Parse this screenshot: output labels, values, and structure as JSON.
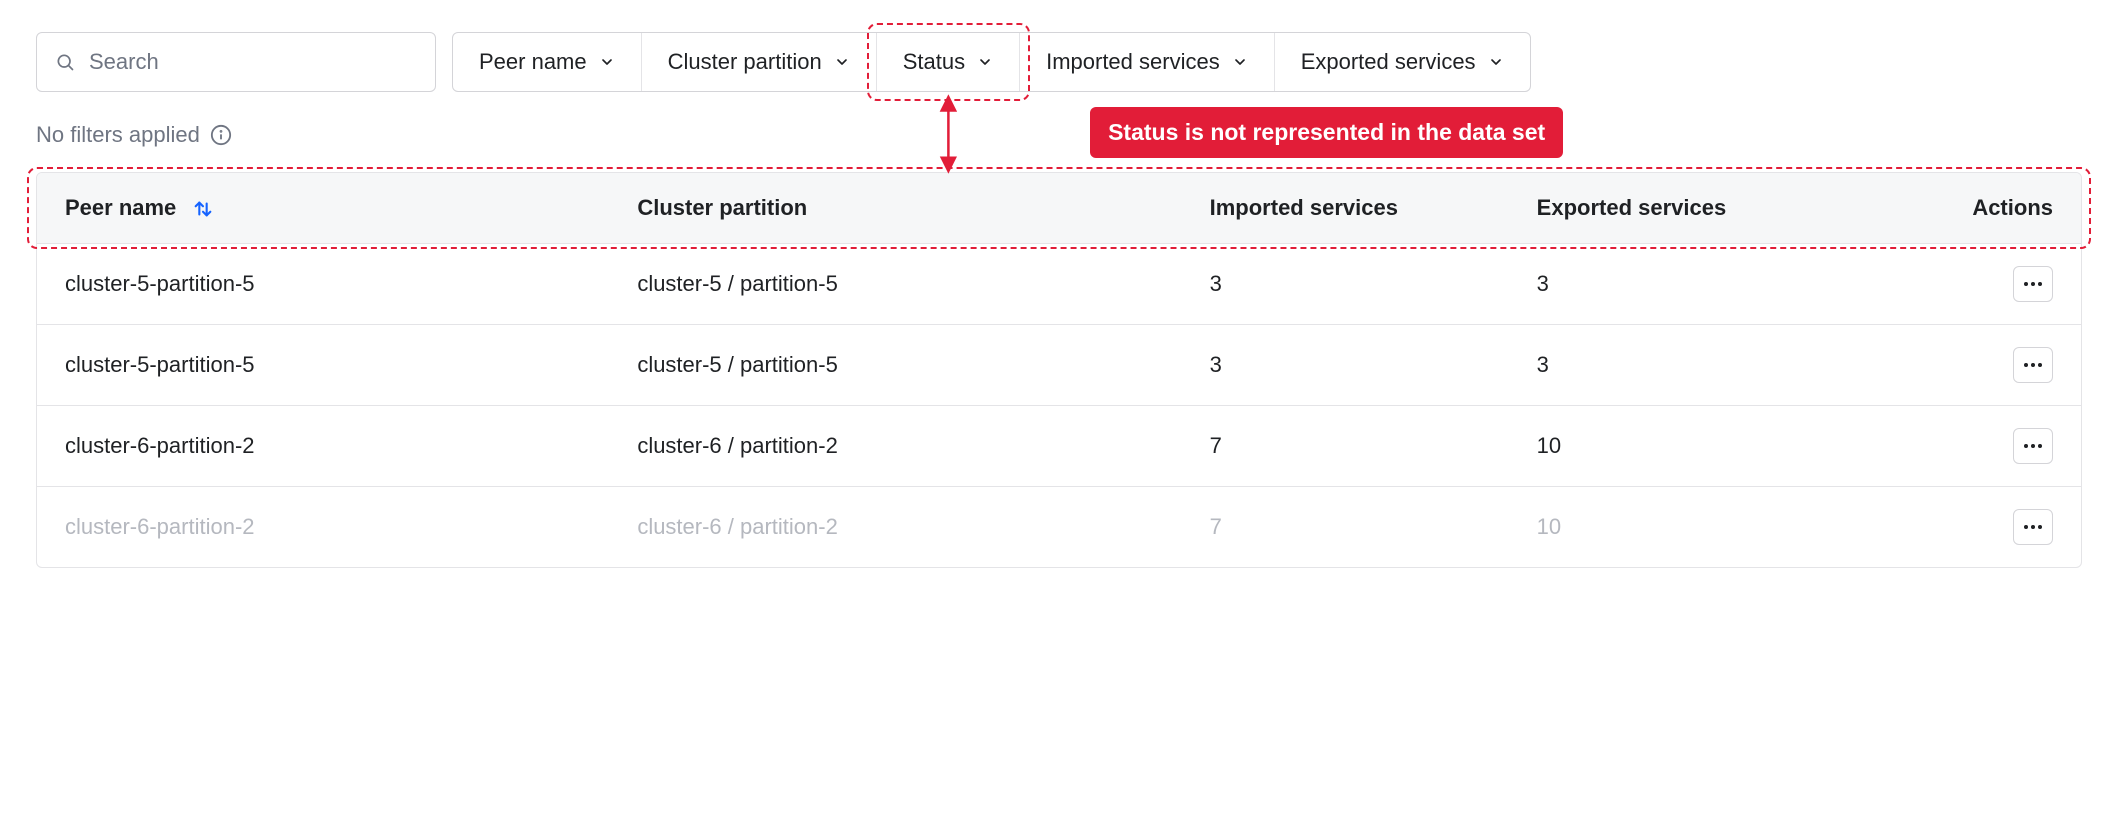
{
  "search": {
    "placeholder": "Search"
  },
  "filters": {
    "items": [
      {
        "label": "Peer name"
      },
      {
        "label": "Cluster partition"
      },
      {
        "label": "Status"
      },
      {
        "label": "Imported services"
      },
      {
        "label": "Exported services"
      }
    ],
    "status_text": "No filters applied"
  },
  "table": {
    "columns": {
      "peer_name": "Peer name",
      "cluster_partition": "Cluster partition",
      "imported": "Imported services",
      "exported": "Exported services",
      "actions": "Actions"
    },
    "rows": [
      {
        "peer_name": "cluster-5-partition-5",
        "cluster_partition": "cluster-5 / partition-5",
        "imported": "3",
        "exported": "3"
      },
      {
        "peer_name": "cluster-5-partition-5",
        "cluster_partition": "cluster-5 / partition-5",
        "imported": "3",
        "exported": "3"
      },
      {
        "peer_name": "cluster-6-partition-2",
        "cluster_partition": "cluster-6 / partition-2",
        "imported": "7",
        "exported": "10"
      },
      {
        "peer_name": "cluster-6-partition-2",
        "cluster_partition": "cluster-6 / partition-2",
        "imported": "7",
        "exported": "10"
      }
    ]
  },
  "annotation": {
    "text": "Status is not represented in the data set"
  }
}
